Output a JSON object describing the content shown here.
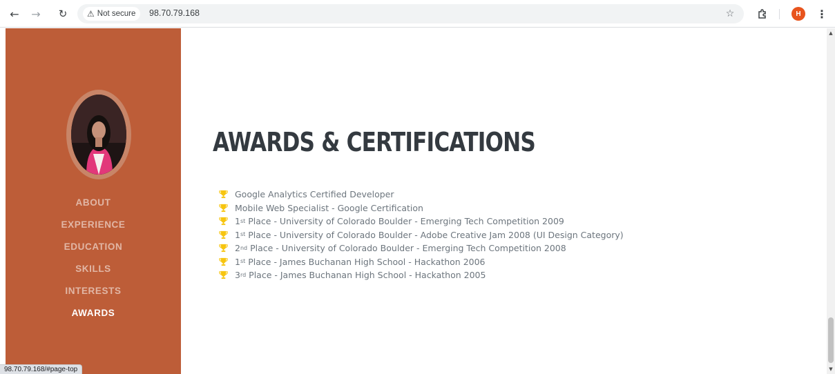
{
  "browser": {
    "security_label": "Not secure",
    "url": "98.70.79.168",
    "status_url": "98.70.79.168/#page-top",
    "profile_initial": "H",
    "profile_color": "#e8541d"
  },
  "sidebar": {
    "bg_color": "#bd5d38",
    "nav": [
      {
        "label": "ABOUT",
        "active": false
      },
      {
        "label": "EXPERIENCE",
        "active": false
      },
      {
        "label": "EDUCATION",
        "active": false
      },
      {
        "label": "SKILLS",
        "active": false
      },
      {
        "label": "INTERESTS",
        "active": false
      },
      {
        "label": "AWARDS",
        "active": true
      }
    ]
  },
  "main": {
    "heading": "AWARDS & CERTIFICATIONS",
    "trophy_color": "#f7c50f",
    "awards": [
      {
        "prefix": "",
        "sup": "",
        "text": "Google Analytics Certified Developer"
      },
      {
        "prefix": "",
        "sup": "",
        "text": "Mobile Web Specialist - Google Certification"
      },
      {
        "prefix": "1",
        "sup": "st",
        "text": " Place - University of Colorado Boulder - Emerging Tech Competition 2009"
      },
      {
        "prefix": "1",
        "sup": "st",
        "text": " Place - University of Colorado Boulder - Adobe Creative Jam 2008 (UI Design Category)"
      },
      {
        "prefix": "2",
        "sup": "nd",
        "text": " Place - University of Colorado Boulder - Emerging Tech Competition 2008"
      },
      {
        "prefix": "1",
        "sup": "st",
        "text": " Place - James Buchanan High School - Hackathon 2006"
      },
      {
        "prefix": "3",
        "sup": "rd",
        "text": " Place - James Buchanan High School - Hackathon 2005"
      }
    ]
  }
}
